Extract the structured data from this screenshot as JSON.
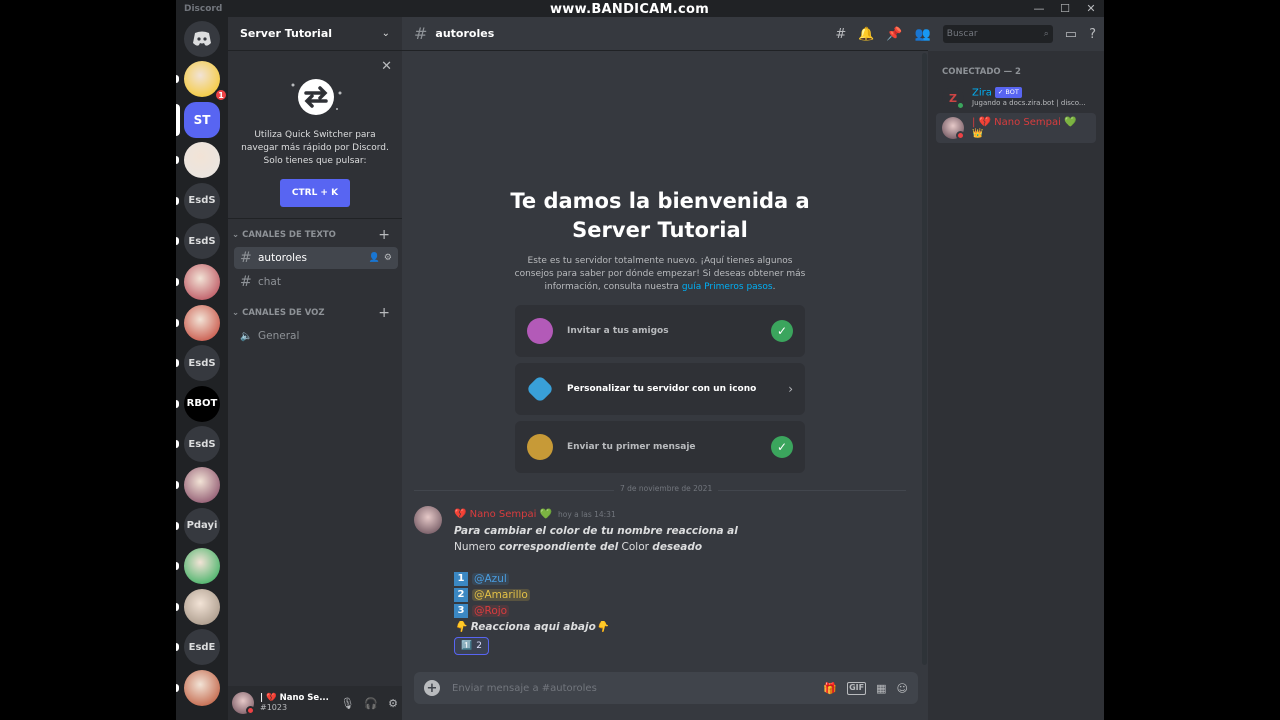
{
  "watermark": "www.BANDICAM.com",
  "app_title": "Discord",
  "colors": {
    "accent": "#5865f2",
    "online": "#3ba55d",
    "dnd": "#ed4245",
    "username": "#d83c3e",
    "link": "#00aff4"
  },
  "servers": [
    {
      "label": "",
      "kind": "avatar",
      "badge": "1"
    },
    {
      "label": "ST",
      "kind": "text",
      "selected": true
    },
    {
      "label": "",
      "kind": "avatar"
    },
    {
      "label": "EsdS",
      "kind": "text"
    },
    {
      "label": "EsdS",
      "kind": "text"
    },
    {
      "label": "",
      "kind": "avatar"
    },
    {
      "label": "",
      "kind": "avatar"
    },
    {
      "label": "EsdS",
      "kind": "text"
    },
    {
      "label": "RBOT",
      "kind": "text"
    },
    {
      "label": "EsdS",
      "kind": "text"
    },
    {
      "label": "",
      "kind": "avatar"
    },
    {
      "label": "Pdayi",
      "kind": "text"
    },
    {
      "label": "",
      "kind": "avatar"
    },
    {
      "label": "",
      "kind": "avatar"
    },
    {
      "label": "EsdE",
      "kind": "text"
    },
    {
      "label": "",
      "kind": "avatar"
    }
  ],
  "server_name": "Server Tutorial",
  "quick_switcher": {
    "text": "Utiliza Quick Switcher para navegar más rápido por Discord. Solo tienes que pulsar:",
    "shortcut": "CTRL + K"
  },
  "categories": {
    "text": "CANALES DE TEXTO",
    "voice": "CANALES DE VOZ"
  },
  "channels": {
    "text": [
      "autoroles",
      "chat"
    ],
    "voice": [
      "General"
    ]
  },
  "current_user": {
    "name": "| 💔 Nano Se...",
    "tag": "#1023"
  },
  "channel_header": {
    "name": "autoroles",
    "search_placeholder": "Buscar"
  },
  "welcome": {
    "title_line1": "Te damos la bienvenida a",
    "title_line2": "Server Tutorial",
    "desc": "Este es tu servidor totalmente nuevo. ¡Aquí tienes algunos consejos para saber por dónde empezar! Si deseas obtener más información, consulta nuestra",
    "link": "guía Primeros pasos",
    "tail": "."
  },
  "cards": [
    {
      "label": "Invitar a tus amigos",
      "done": true
    },
    {
      "label": "Personalizar tu servidor con un icono",
      "done": false
    },
    {
      "label": "Enviar tu primer mensaje",
      "done": true
    }
  ],
  "date_divider": "7 de noviembre de 2021",
  "message": {
    "author": "💔 Nano Sempai 💚",
    "time": "hoy a las 14:31",
    "line1": "Para cambiar el color de tu nombre reacciona al",
    "line2_a": "Numero",
    "line2_b": "correspondiente del",
    "line2_c": "Color",
    "line2_d": "deseado",
    "roles": [
      {
        "num": "1",
        "mention": "@Azul",
        "color": "#4a9de0"
      },
      {
        "num": "2",
        "mention": "@Amarillo",
        "color": "#e2c047"
      },
      {
        "num": "3",
        "mention": "@Rojo",
        "color": "#d83c3e"
      }
    ],
    "footer": "👇 Reacciona aqui abajo👇",
    "reaction": {
      "emoji": "1️⃣",
      "count": "2"
    }
  },
  "input_placeholder": "Enviar mensaje a #autoroles",
  "members": {
    "header": "CONECTADO — 2",
    "list": [
      {
        "name": "Zira",
        "bot": "✓ BOT",
        "status": "Jugando a docs.zira.bot | disco...",
        "color": "#00aff4",
        "dot": "#3ba55d"
      },
      {
        "name": "| 💔 Nano Sempai 💚",
        "crown": "👑",
        "color": "#d83c3e",
        "dot": "#ed4245"
      }
    ]
  }
}
